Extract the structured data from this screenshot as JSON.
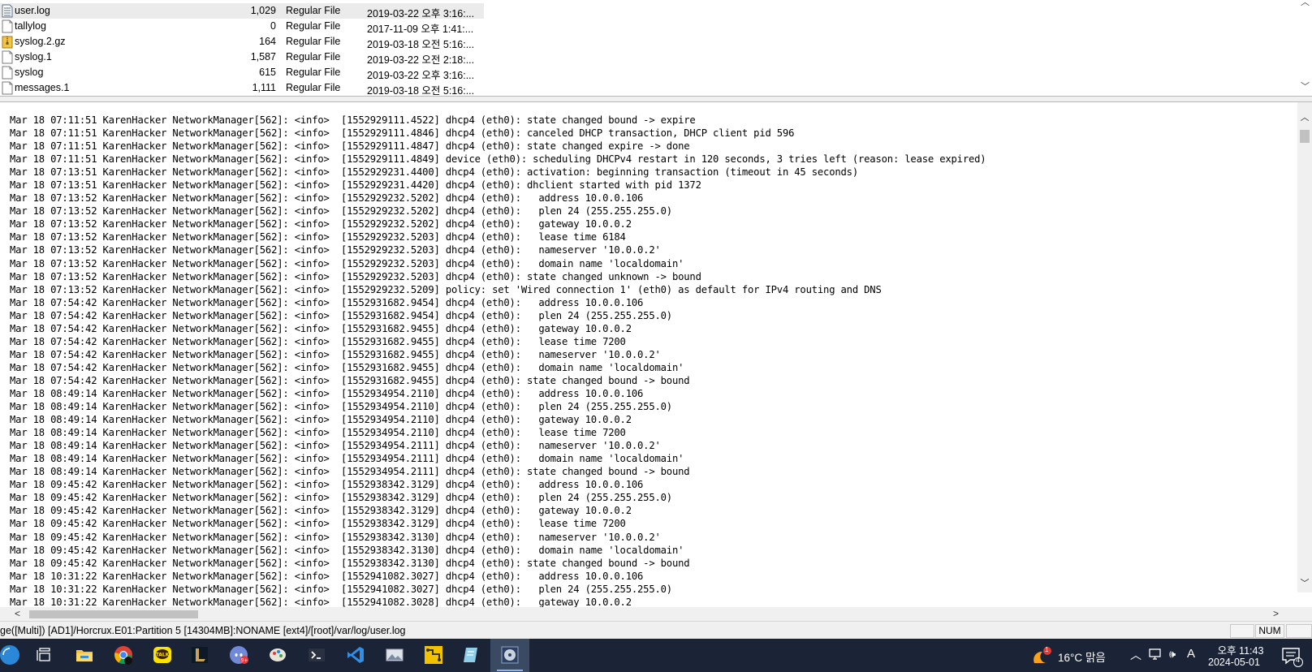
{
  "file_list": {
    "rows": [
      {
        "name": "user.log",
        "size": "1,029",
        "type": "Regular File",
        "date": "2019-03-22 오후 3:16:...",
        "icon": "log-file-icon",
        "selected": true
      },
      {
        "name": "tallylog",
        "size": "0",
        "type": "Regular File",
        "date": "2017-11-09 오후 1:41:...",
        "icon": "file-icon",
        "selected": false
      },
      {
        "name": "syslog.2.gz",
        "size": "164",
        "type": "Regular File",
        "date": "2019-03-18 오전 5:16:...",
        "icon": "archive-file-icon",
        "selected": false
      },
      {
        "name": "syslog.1",
        "size": "1,587",
        "type": "Regular File",
        "date": "2019-03-22 오전 2:18:...",
        "icon": "file-icon",
        "selected": false
      },
      {
        "name": "syslog",
        "size": "615",
        "type": "Regular File",
        "date": "2019-03-22 오후 3:16:...",
        "icon": "file-icon",
        "selected": false
      },
      {
        "name": "messages.1",
        "size": "1,111",
        "type": "Regular File",
        "date": "2019-03-18 오전 5:16:...",
        "icon": "file-icon",
        "selected": false
      }
    ]
  },
  "log_lines": [
    "Mar 18 07:11:51 KarenHacker NetworkManager[562]: <info>  [1552929111.4522] dhcp4 (eth0): state changed bound -> expire",
    "Mar 18 07:11:51 KarenHacker NetworkManager[562]: <info>  [1552929111.4846] dhcp4 (eth0): canceled DHCP transaction, DHCP client pid 596",
    "Mar 18 07:11:51 KarenHacker NetworkManager[562]: <info>  [1552929111.4847] dhcp4 (eth0): state changed expire -> done",
    "Mar 18 07:11:51 KarenHacker NetworkManager[562]: <info>  [1552929111.4849] device (eth0): scheduling DHCPv4 restart in 120 seconds, 3 tries left (reason: lease expired)",
    "Mar 18 07:13:51 KarenHacker NetworkManager[562]: <info>  [1552929231.4400] dhcp4 (eth0): activation: beginning transaction (timeout in 45 seconds)",
    "Mar 18 07:13:51 KarenHacker NetworkManager[562]: <info>  [1552929231.4420] dhcp4 (eth0): dhclient started with pid 1372",
    "Mar 18 07:13:52 KarenHacker NetworkManager[562]: <info>  [1552929232.5202] dhcp4 (eth0):   address 10.0.0.106",
    "Mar 18 07:13:52 KarenHacker NetworkManager[562]: <info>  [1552929232.5202] dhcp4 (eth0):   plen 24 (255.255.255.0)",
    "Mar 18 07:13:52 KarenHacker NetworkManager[562]: <info>  [1552929232.5202] dhcp4 (eth0):   gateway 10.0.0.2",
    "Mar 18 07:13:52 KarenHacker NetworkManager[562]: <info>  [1552929232.5203] dhcp4 (eth0):   lease time 6184",
    "Mar 18 07:13:52 KarenHacker NetworkManager[562]: <info>  [1552929232.5203] dhcp4 (eth0):   nameserver '10.0.0.2'",
    "Mar 18 07:13:52 KarenHacker NetworkManager[562]: <info>  [1552929232.5203] dhcp4 (eth0):   domain name 'localdomain'",
    "Mar 18 07:13:52 KarenHacker NetworkManager[562]: <info>  [1552929232.5203] dhcp4 (eth0): state changed unknown -> bound",
    "Mar 18 07:13:52 KarenHacker NetworkManager[562]: <info>  [1552929232.5209] policy: set 'Wired connection 1' (eth0) as default for IPv4 routing and DNS",
    "Mar 18 07:54:42 KarenHacker NetworkManager[562]: <info>  [1552931682.9454] dhcp4 (eth0):   address 10.0.0.106",
    "Mar 18 07:54:42 KarenHacker NetworkManager[562]: <info>  [1552931682.9454] dhcp4 (eth0):   plen 24 (255.255.255.0)",
    "Mar 18 07:54:42 KarenHacker NetworkManager[562]: <info>  [1552931682.9455] dhcp4 (eth0):   gateway 10.0.0.2",
    "Mar 18 07:54:42 KarenHacker NetworkManager[562]: <info>  [1552931682.9455] dhcp4 (eth0):   lease time 7200",
    "Mar 18 07:54:42 KarenHacker NetworkManager[562]: <info>  [1552931682.9455] dhcp4 (eth0):   nameserver '10.0.0.2'",
    "Mar 18 07:54:42 KarenHacker NetworkManager[562]: <info>  [1552931682.9455] dhcp4 (eth0):   domain name 'localdomain'",
    "Mar 18 07:54:42 KarenHacker NetworkManager[562]: <info>  [1552931682.9455] dhcp4 (eth0): state changed bound -> bound",
    "Mar 18 08:49:14 KarenHacker NetworkManager[562]: <info>  [1552934954.2110] dhcp4 (eth0):   address 10.0.0.106",
    "Mar 18 08:49:14 KarenHacker NetworkManager[562]: <info>  [1552934954.2110] dhcp4 (eth0):   plen 24 (255.255.255.0)",
    "Mar 18 08:49:14 KarenHacker NetworkManager[562]: <info>  [1552934954.2110] dhcp4 (eth0):   gateway 10.0.0.2",
    "Mar 18 08:49:14 KarenHacker NetworkManager[562]: <info>  [1552934954.2110] dhcp4 (eth0):   lease time 7200",
    "Mar 18 08:49:14 KarenHacker NetworkManager[562]: <info>  [1552934954.2111] dhcp4 (eth0):   nameserver '10.0.0.2'",
    "Mar 18 08:49:14 KarenHacker NetworkManager[562]: <info>  [1552934954.2111] dhcp4 (eth0):   domain name 'localdomain'",
    "Mar 18 08:49:14 KarenHacker NetworkManager[562]: <info>  [1552934954.2111] dhcp4 (eth0): state changed bound -> bound",
    "Mar 18 09:45:42 KarenHacker NetworkManager[562]: <info>  [1552938342.3129] dhcp4 (eth0):   address 10.0.0.106",
    "Mar 18 09:45:42 KarenHacker NetworkManager[562]: <info>  [1552938342.3129] dhcp4 (eth0):   plen 24 (255.255.255.0)",
    "Mar 18 09:45:42 KarenHacker NetworkManager[562]: <info>  [1552938342.3129] dhcp4 (eth0):   gateway 10.0.0.2",
    "Mar 18 09:45:42 KarenHacker NetworkManager[562]: <info>  [1552938342.3129] dhcp4 (eth0):   lease time 7200",
    "Mar 18 09:45:42 KarenHacker NetworkManager[562]: <info>  [1552938342.3130] dhcp4 (eth0):   nameserver '10.0.0.2'",
    "Mar 18 09:45:42 KarenHacker NetworkManager[562]: <info>  [1552938342.3130] dhcp4 (eth0):   domain name 'localdomain'",
    "Mar 18 09:45:42 KarenHacker NetworkManager[562]: <info>  [1552938342.3130] dhcp4 (eth0): state changed bound -> bound",
    "Mar 18 10:31:22 KarenHacker NetworkManager[562]: <info>  [1552941082.3027] dhcp4 (eth0):   address 10.0.0.106",
    "Mar 18 10:31:22 KarenHacker NetworkManager[562]: <info>  [1552941082.3027] dhcp4 (eth0):   plen 24 (255.255.255.0)",
    "Mar 18 10:31:22 KarenHacker NetworkManager[562]: <info>  [1552941082.3028] dhcp4 (eth0):   gateway 10.0.0.2"
  ],
  "status_bar": {
    "path": "ge([Multi]) [AD1]/Horcrux.E01:Partition 5 [14304MB]:NONAME [ext4]/[root]/var/log/user.log",
    "num_indicator": "NUM"
  },
  "taskbar": {
    "apps": [
      {
        "name": "start-button",
        "icon": "windows-start-icon",
        "active": false
      },
      {
        "name": "task-view-button",
        "icon": "task-view-icon",
        "active": false
      },
      {
        "name": "file-explorer-button",
        "icon": "folder-icon",
        "active": false
      },
      {
        "name": "chrome-button",
        "icon": "chrome-icon",
        "active": false
      },
      {
        "name": "kakaotalk-button",
        "icon": "kakaotalk-icon",
        "active": false
      },
      {
        "name": "league-button",
        "icon": "league-icon",
        "active": false
      },
      {
        "name": "discord-button",
        "icon": "discord-icon",
        "active": false
      },
      {
        "name": "paint-app-button",
        "icon": "paint-icon",
        "active": false
      },
      {
        "name": "terminal-button",
        "icon": "terminal-icon",
        "active": false
      },
      {
        "name": "vscode-button",
        "icon": "vscode-icon",
        "active": false
      },
      {
        "name": "image-viewer-button",
        "icon": "photos-icon",
        "active": false
      },
      {
        "name": "network-tool-button",
        "icon": "network-tool-icon",
        "active": false
      },
      {
        "name": "notepad-button",
        "icon": "notepad-icon",
        "active": false
      },
      {
        "name": "ftk-imager-button",
        "icon": "disk-imager-icon",
        "active": true
      }
    ],
    "weather": {
      "temp": "16°C",
      "condition": "맑음",
      "badge": "1",
      "icon": "weather-sun-icon"
    },
    "tray": {
      "ime": "A"
    },
    "clock": {
      "time": "오후 11:43",
      "date": "2024-05-01"
    },
    "notifications": {
      "count": "4",
      "icon": "notification-icon"
    }
  },
  "colors": {
    "taskbar_bg": "#1a2436",
    "selection_bg": "#ebebeb",
    "vscode_blue": "#2f8ee8",
    "start_blue": "#2b88d8"
  }
}
